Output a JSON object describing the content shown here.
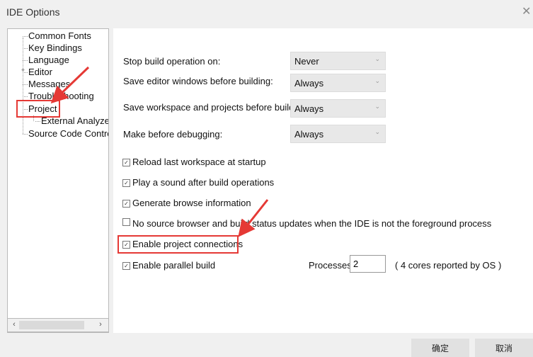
{
  "window": {
    "title": "IDE Options",
    "close_icon": "close-icon"
  },
  "tree": {
    "items": [
      "Common Fonts",
      "Key Bindings",
      "Language",
      "Editor",
      "Messages",
      "Troubleshooting",
      "Project",
      "External Analyzer",
      "Source Code Contro"
    ],
    "selected": "Project",
    "scroll_left": "‹",
    "scroll_right": "›",
    "expander": "+"
  },
  "build": {
    "stop_label": "Stop build operation on:",
    "stop_value": "Never",
    "save_editor_label": "Save editor windows before building:",
    "save_editor_value": "Always",
    "save_workspace_label": "Save workspace and projects before building:",
    "save_workspace_value": "Always",
    "make_label": "Make before debugging:",
    "make_value": "Always",
    "arrow_glyph": "⌄"
  },
  "options": {
    "reload": {
      "label": "Reload last workspace at startup",
      "checked": true
    },
    "sound": {
      "label": "Play a sound after build operations",
      "checked": true
    },
    "browse": {
      "label": "Generate browse information",
      "checked": true
    },
    "no_source": {
      "label": "No source browser and build status updates when the IDE is not the foreground process",
      "checked": false
    },
    "project_connections": {
      "label": "Enable project connections",
      "checked": true
    },
    "parallel": {
      "label": "Enable parallel build",
      "checked": true
    }
  },
  "parallel": {
    "processes_label": "Processes:",
    "processes_value": "2",
    "cores_note": "( 4 cores reported by OS )"
  },
  "buttons": {
    "ok": "确定",
    "cancel": "取消"
  },
  "colors": {
    "highlight": "#e53935",
    "window_bg": "#f0f0f0",
    "pane_bg": "#ffffff"
  }
}
